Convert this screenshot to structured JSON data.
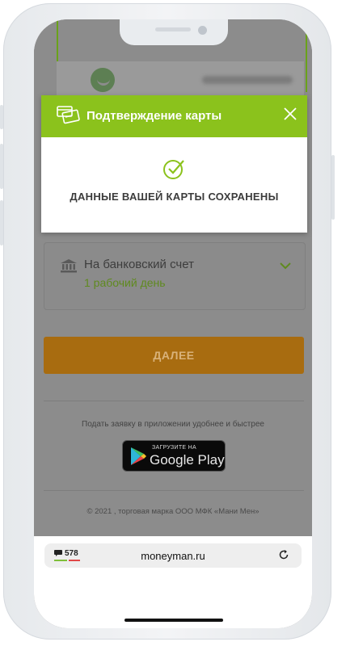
{
  "modal": {
    "title": "Подтверждение карты",
    "message": "ДАННЫЕ ВАШЕЙ КАРТЫ СОХРАНЕНЫ"
  },
  "payout": {
    "method_title": "На банковский счет",
    "method_time": "1 рабочий день"
  },
  "next_button": "ДАЛЕЕ",
  "app_promo": {
    "text": "Подать заявку в приложении удобнее и быстрее",
    "store_small": "ЗАГРУЗИТЕ НА",
    "store_big": "Google Play"
  },
  "footer": {
    "copyright": "© 2021 , торговая марка ООО МФК «Мани Мен»"
  },
  "browser": {
    "tabs_count": "578",
    "url": "moneyman.ru"
  },
  "colors": {
    "accent_green": "#8bc21c",
    "button_orange_dimmed": "#a86c10"
  },
  "icons": [
    "card-icon",
    "close-icon",
    "checkmark-icon",
    "bank-icon",
    "chevron-down-icon",
    "google-play-icon",
    "chat-bubble-icon",
    "reload-icon"
  ]
}
